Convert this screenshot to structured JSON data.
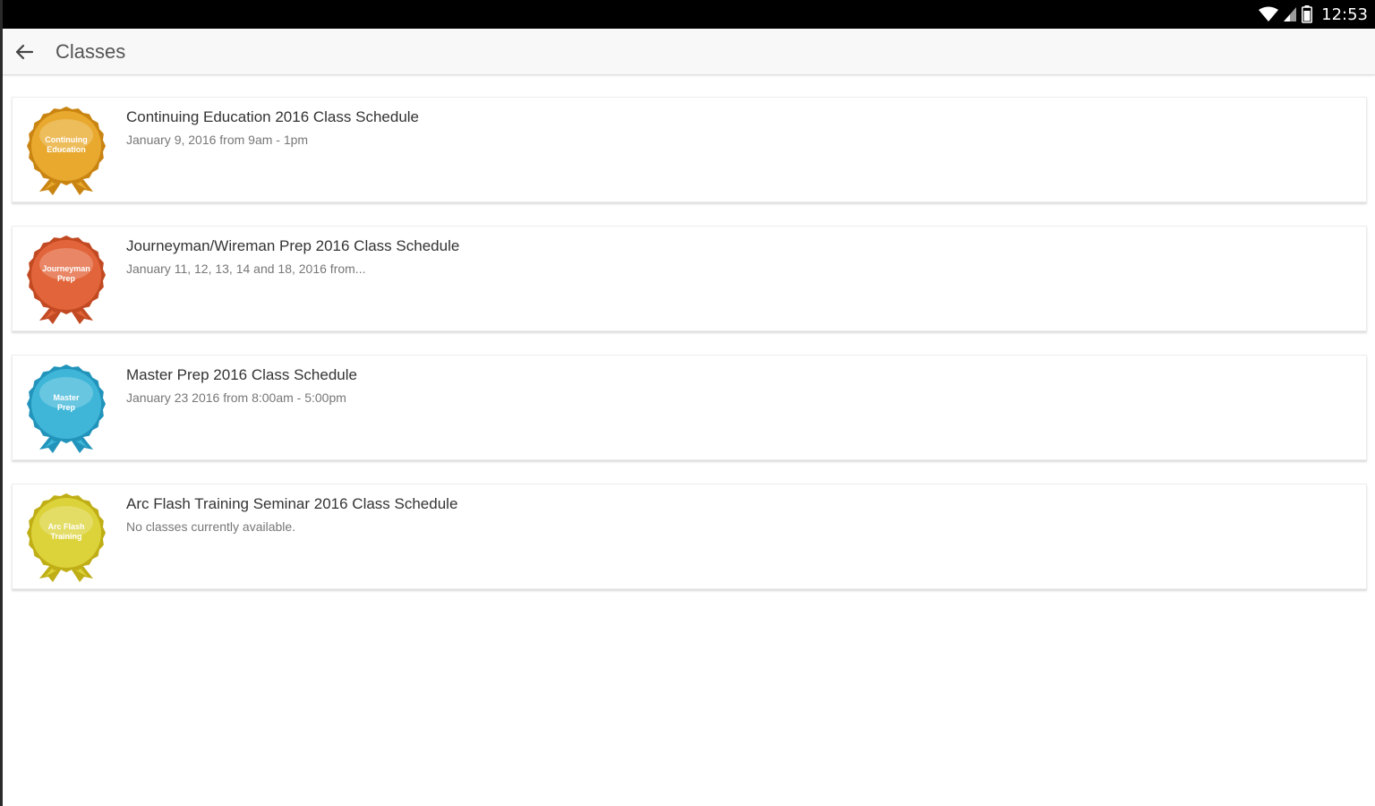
{
  "status_bar": {
    "time": "12:53",
    "icons": [
      "wifi-icon",
      "signal-icon",
      "battery-icon"
    ]
  },
  "app_bar": {
    "back_icon": "arrow-left-icon",
    "title": "Classes"
  },
  "classes": [
    {
      "title": "Continuing Education 2016 Class Schedule",
      "subtitle": "January 9, 2016 from 9am - 1pm",
      "badge_label": [
        "Continuing",
        "Education"
      ],
      "badge_color": "#e8a92e",
      "badge_dark": "#c98412"
    },
    {
      "title": "Journeyman/Wireman Prep 2016 Class Schedule",
      "subtitle": "January 11, 12, 13, 14 and 18, 2016 from...",
      "badge_label": [
        "Journeyman",
        "Prep"
      ],
      "badge_color": "#e2643a",
      "badge_dark": "#c24a22"
    },
    {
      "title": "Master Prep 2016 Class Schedule",
      "subtitle": "January 23 2016 from 8:00am - 5:00pm",
      "badge_label": [
        "Master",
        "Prep"
      ],
      "badge_color": "#3fb6d8",
      "badge_dark": "#2294bb"
    },
    {
      "title": "Arc Flash Training Seminar 2016 Class Schedule",
      "subtitle": "No classes currently available.",
      "badge_label": [
        "Arc Flash",
        "Training"
      ],
      "badge_color": "#dcd23a",
      "badge_dark": "#bfae16"
    }
  ]
}
